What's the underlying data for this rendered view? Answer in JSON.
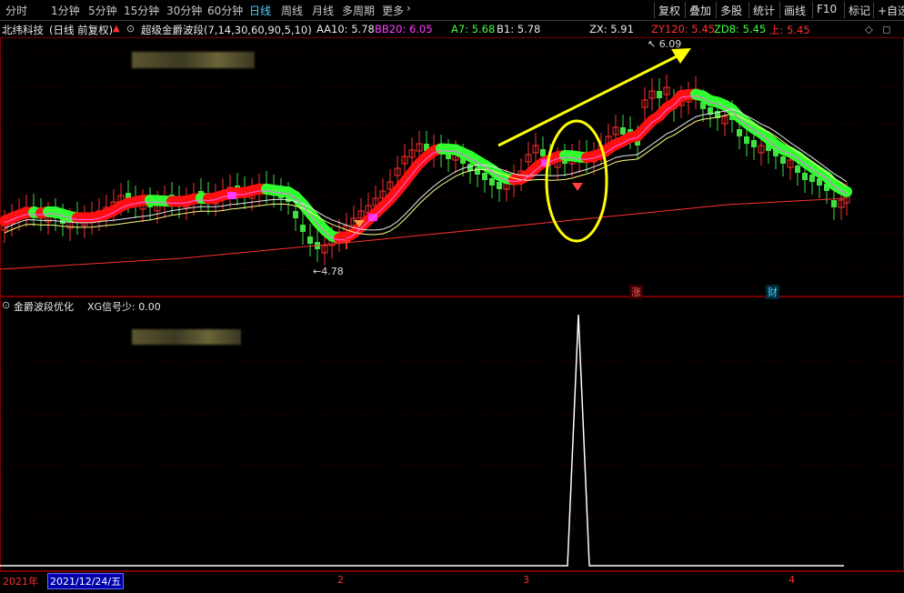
{
  "toolbar": {
    "periods": [
      "分时",
      "1分钟",
      "5分钟",
      "15分钟",
      "30分钟",
      "60分钟",
      "日线",
      "周线",
      "月线",
      "多周期",
      "更多"
    ],
    "active_period": "日线",
    "right_buttons": [
      "复权",
      "叠加",
      "多股",
      "统计",
      "画线",
      "F10",
      "标记",
      "+自选"
    ]
  },
  "header": {
    "stock_name": "北纬科技",
    "chart_mode": "(日线 前复权)",
    "indicator_name": "超级金爵波段(7,14,30,60,90,5,10)",
    "values": [
      {
        "label": "AA10: 5.78",
        "color": "#e8e8e8"
      },
      {
        "label": "BB20: 6.05",
        "color": "#ff40ff"
      },
      {
        "label": "A7: 5.68",
        "color": "#40ff40"
      },
      {
        "label": "B1: 5.78",
        "color": "#e8e8e8"
      },
      {
        "label": "ZX: 5.91",
        "color": "#e8e8e8"
      },
      {
        "label": "ZY120: 5.45",
        "color": "#ff3030"
      },
      {
        "label": "ZD8: 5.45",
        "color": "#40ff40"
      },
      {
        "label": "上: 5.45",
        "color": "#ff3030"
      }
    ]
  },
  "main_chart": {
    "high_label": "6.09",
    "low_label": "4.78",
    "badge_zhang": "涨",
    "badge_cai": "财"
  },
  "sub_chart": {
    "title": "金爵波段优化",
    "value_label": "XG信号少: 0.00",
    "series": [
      {
        "name": "XG信号少",
        "spike_index": 0,
        "spike_value": 1
      }
    ]
  },
  "date_axis": {
    "year_label": "2021年",
    "cursor_date": "2021/12/24/五",
    "month_ticks": [
      "2",
      "3",
      "4"
    ]
  },
  "colors": {
    "up": "#ff3030",
    "down": "#40e040",
    "accent": "#4fd3ff",
    "annotation": "#ffff00"
  }
}
